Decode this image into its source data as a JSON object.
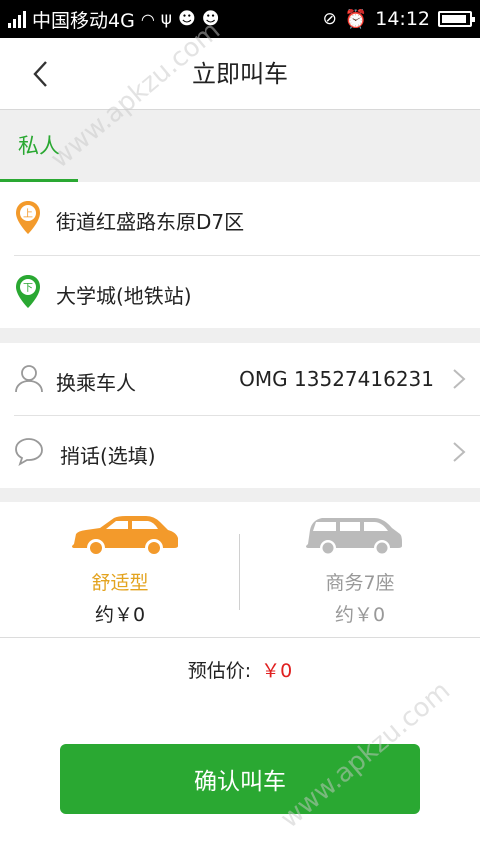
{
  "status_bar": {
    "carrier": "中国移动4G",
    "time": "14:12"
  },
  "nav": {
    "title": "立即叫车"
  },
  "tabs": [
    {
      "label": "私人",
      "selected": true
    }
  ],
  "locations": {
    "start": {
      "badge": "上",
      "text": "街道红盛路东原D7区",
      "color": "#f39a2b"
    },
    "end": {
      "badge": "下",
      "text": "大学城(地铁站)",
      "color": "#2aa832"
    }
  },
  "passenger": {
    "label": "换乘车人",
    "value": "OMG 13527416231"
  },
  "message": {
    "label": "捎话(选填)"
  },
  "car_types": [
    {
      "name": "舒适型",
      "price": "约￥0",
      "selected": true,
      "color": "#f39a2b"
    },
    {
      "name": "商务7座",
      "price": "约￥0",
      "selected": false,
      "color": "#bbbbbb"
    }
  ],
  "estimate": {
    "label": "预估价:",
    "amount": "￥0"
  },
  "confirm_button": {
    "label": "确认叫车"
  },
  "watermark": {
    "text_top": "www.apkzu.com",
    "text_bottom": "www.apkzu.com"
  },
  "colors": {
    "accent": "#2aa832",
    "warning": "#f39a2b",
    "price": "#e02020"
  }
}
